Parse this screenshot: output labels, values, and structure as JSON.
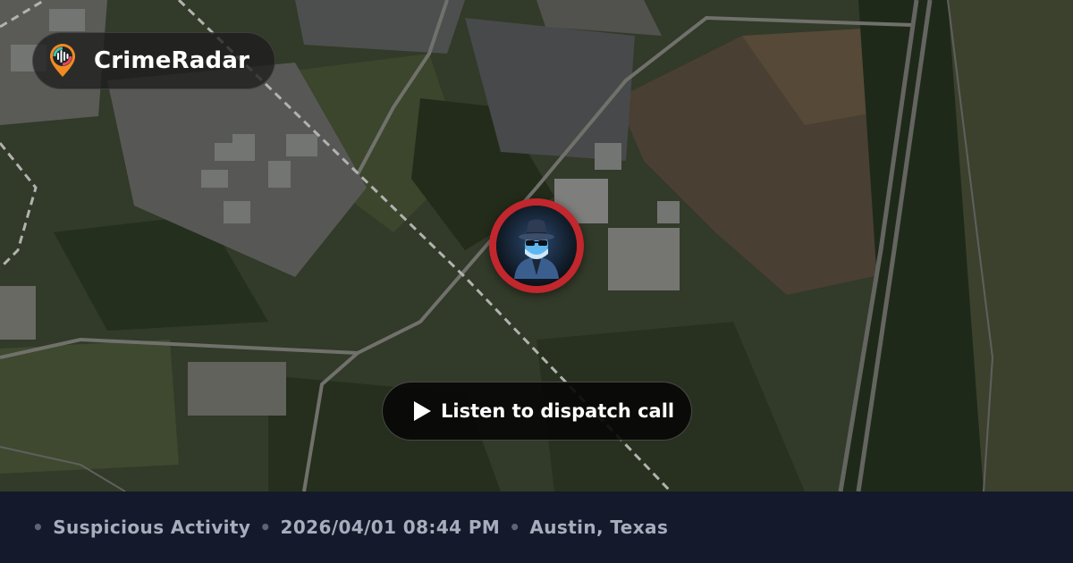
{
  "brand": {
    "name": "CrimeRadar",
    "logo_icon": "radar-pin-icon"
  },
  "map": {
    "type": "satellite",
    "marker_icon": "hooded-suspect-icon",
    "marker_ring_color": "#c1272d"
  },
  "action": {
    "label": "Listen to dispatch call",
    "icon": "play-icon"
  },
  "meta": {
    "separator": "•",
    "category": "Suspicious Activity",
    "datetime": "2026/04/01 08:44 PM",
    "location": "Austin, Texas"
  }
}
